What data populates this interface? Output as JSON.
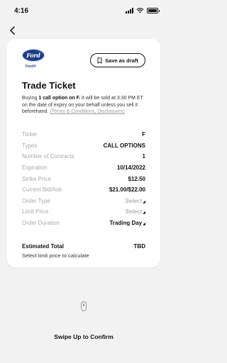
{
  "status_bar": {
    "time": "4:16",
    "icons": [
      "signal-icon",
      "wifi-icon",
      "battery-icon"
    ]
  },
  "header": {
    "back_icon": "chevron-left-icon"
  },
  "brand": {
    "logo_text": "Ford",
    "sub_text": "Ford®",
    "brand_color": "#1b3f88"
  },
  "toolbar": {
    "save_draft_label": "Save as draft",
    "save_draft_icon": "bookmark-icon"
  },
  "ticket": {
    "title": "Trade Ticket",
    "desc_pre": "Buying ",
    "desc_bold": "1 call option on F.",
    "desc_mid": " It will be sold at 3:30 PM ET on the date of expiry on your behalf unless you sell it beforehand. ",
    "desc_link": "(Terms & Conditions, Disclosures)",
    "rows": [
      {
        "label": "Ticker",
        "value": "F"
      },
      {
        "label": "Types",
        "value": "CALL OPTIONS"
      },
      {
        "label": "Number of Contracts",
        "value": "1"
      },
      {
        "label": "Expiration",
        "value": "10/14/2022"
      },
      {
        "label": "Strike Price",
        "value": "$12.50"
      },
      {
        "label": "Current Bid/Ask",
        "value": "$21.00/$22.00"
      },
      {
        "label": "Order Type",
        "value": "Select"
      },
      {
        "label": "Limit Price",
        "value": "Select"
      },
      {
        "label": "Order Duration",
        "value": "Trading Day"
      }
    ],
    "estimated_total_label": "Estimated Total",
    "estimated_total_value": "TBD",
    "estimated_note": "Select limit price to calculate"
  },
  "footer": {
    "swipe_label": "Swipe Up to Confirm",
    "swipe_icon": "swipe-handle-icon"
  }
}
